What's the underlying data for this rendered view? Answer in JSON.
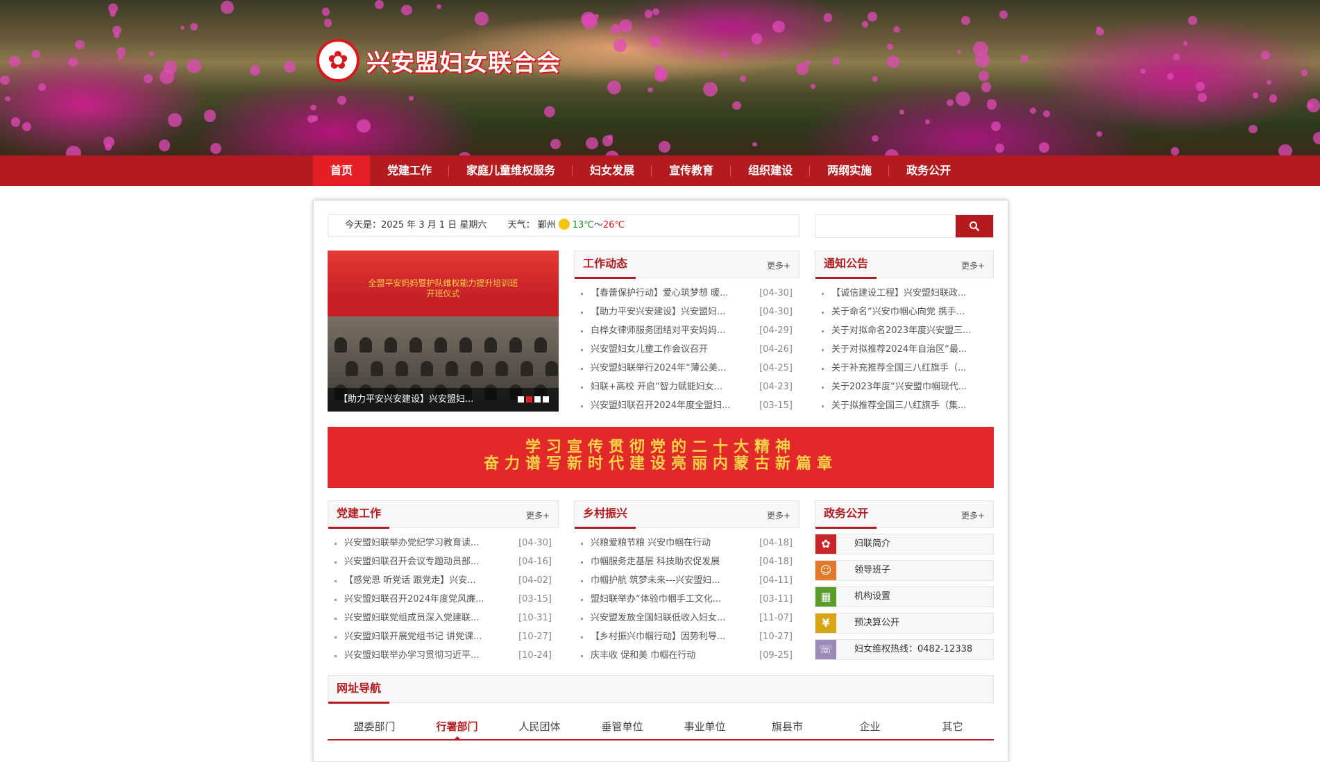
{
  "site": {
    "title": "兴安盟妇女联合会"
  },
  "nav": [
    {
      "label": "首页"
    },
    {
      "label": "党建工作"
    },
    {
      "label": "家庭儿童维权服务"
    },
    {
      "label": "妇女发展"
    },
    {
      "label": "宣传教育"
    },
    {
      "label": "组织建设"
    },
    {
      "label": "两纲实施"
    },
    {
      "label": "政务公开"
    }
  ],
  "info": {
    "date_text": "今天是：2025 年 3 月 1 日 星期六",
    "weather_label": "天气：",
    "city": "鄞州",
    "temp_low": "13℃",
    "temp_sep": "～",
    "temp_high": "26℃"
  },
  "search": {
    "placeholder": ""
  },
  "slider": {
    "stage_text": "全盟平安妈妈暨护队维权能力提升培训班\n开班仪式",
    "caption": "【助力平安兴安建设】兴安盟妇...",
    "pages": 4,
    "active_page": 2
  },
  "more_label": "更多+",
  "work": {
    "title": "工作动态",
    "items": [
      {
        "text": "【春蕾保护行动】爱心筑梦想 暖...",
        "date": "[04-30]"
      },
      {
        "text": "【助力平安兴安建设】兴安盟妇...",
        "date": "[04-30]"
      },
      {
        "text": "白桦女律师服务团结对平安妈妈...",
        "date": "[04-29]"
      },
      {
        "text": "兴安盟妇女儿童工作会议召开",
        "date": "[04-26]"
      },
      {
        "text": "兴安盟妇联举行2024年“薄公美...",
        "date": "[04-25]"
      },
      {
        "text": "妇联+高校 开启“智力赋能妇女...",
        "date": "[04-23]"
      },
      {
        "text": "兴安盟妇联召开2024年度全盟妇...",
        "date": "[03-15]"
      }
    ]
  },
  "notice": {
    "title": "通知公告",
    "items": [
      {
        "text": "【诚信建设工程】兴安盟妇联政..."
      },
      {
        "text": "关于命名“兴安巾帼心向党 携手..."
      },
      {
        "text": "关于对拟命名2023年度兴安盟三..."
      },
      {
        "text": "关于对拟推荐2024年自治区“最..."
      },
      {
        "text": "关于补充推荐全国三八红旗手（..."
      },
      {
        "text": "关于2023年度“兴安盟巾帼现代..."
      },
      {
        "text": "关于拟推荐全国三八红旗手（集..."
      }
    ]
  },
  "banner": {
    "line1": "学习宣传贯彻党的二十大精神",
    "line2": "奋力谱写新时代建设亮丽内蒙古新篇章"
  },
  "party": {
    "title": "党建工作",
    "items": [
      {
        "text": "兴安盟妇联举办党纪学习教育读...",
        "date": "[04-30]"
      },
      {
        "text": "兴安盟妇联召开会议专题动员部...",
        "date": "[04-16]"
      },
      {
        "text": "【感党恩 听党话 跟党走】兴安...",
        "date": "[04-02]"
      },
      {
        "text": "兴安盟妇联召开2024年度党风廉...",
        "date": "[03-15]"
      },
      {
        "text": "兴安盟妇联党组成员深入党建联...",
        "date": "[10-31]"
      },
      {
        "text": "兴安盟妇联开展党组书记 讲党课...",
        "date": "[10-27]"
      },
      {
        "text": "兴安盟妇联举办学习贯彻习近平...",
        "date": "[10-24]"
      }
    ]
  },
  "rural": {
    "title": "乡村振兴",
    "items": [
      {
        "text": "兴粮爱粮节粮 兴安巾帼在行动",
        "date": "[04-18]"
      },
      {
        "text": "巾帼服务走基层 科技助农促发展",
        "date": "[04-18]"
      },
      {
        "text": "巾帼护航 筑梦未来---兴安盟妇...",
        "date": "[04-11]"
      },
      {
        "text": "盟妇联举办“体验巾帼手工文化...",
        "date": "[03-11]"
      },
      {
        "text": "兴安盟发放全国妇联低收入妇女...",
        "date": "[11-07]"
      },
      {
        "text": "【乡村振兴巾帼行动】因势利导...",
        "date": "[10-27]"
      },
      {
        "text": "庆丰收 促和美 巾帼在行动",
        "date": "[09-25]"
      }
    ]
  },
  "gov": {
    "title": "政务公开",
    "items": [
      {
        "label": "妇联简介",
        "icon": "women-federation-logo-icon",
        "color": "#c9252b"
      },
      {
        "label": "领导班子",
        "icon": "user-icon",
        "color": "#e2792a"
      },
      {
        "label": "机构设置",
        "icon": "org-chart-icon",
        "color": "#5a9d2a"
      },
      {
        "label": "预决算公开",
        "icon": "coin-icon",
        "color": "#d8a514"
      },
      {
        "label": "妇女维权热线：0482-12338",
        "icon": "phone-icon",
        "color": "#9a8ab5"
      }
    ]
  },
  "links": {
    "title": "网址导航",
    "tabs": [
      "盟委部门",
      "行署部门",
      "人民团体",
      "垂管单位",
      "事业单位",
      "旗县市",
      "企业",
      "其它"
    ],
    "active": 1
  },
  "colors": {
    "brand": "#b31b1f",
    "active_nav": "#e31e24"
  }
}
